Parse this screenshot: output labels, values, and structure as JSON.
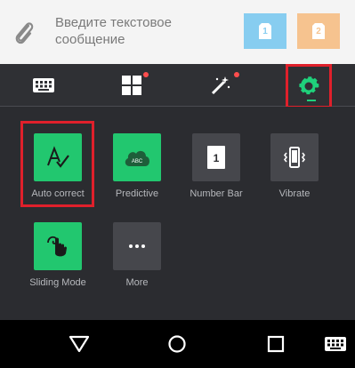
{
  "message_bar": {
    "placeholder": "Введите текстовое сообщение",
    "sim1_label": "1",
    "sim2_label": "2",
    "sim1_color": "#87cdf0",
    "sim2_color": "#f6c38f"
  },
  "toolbar": {
    "items": [
      {
        "icon": "keyboard-icon"
      },
      {
        "icon": "grid-icon",
        "badge": true
      },
      {
        "icon": "magic-wand-icon",
        "badge": true
      },
      {
        "icon": "gear-icon",
        "active": true
      }
    ]
  },
  "settings": {
    "tiles": [
      {
        "label": "Auto correct",
        "icon": "auto-correct-icon",
        "enabled": true
      },
      {
        "label": "Predictive",
        "icon": "predictive-cloud-icon",
        "enabled": true,
        "icon_text": "ABC"
      },
      {
        "label": "Number Bar",
        "icon": "number-bar-icon",
        "enabled": false,
        "icon_text": "1"
      },
      {
        "label": "Vibrate",
        "icon": "vibrate-phone-icon",
        "enabled": false
      },
      {
        "label": "Sliding Mode",
        "icon": "sliding-hand-icon",
        "enabled": true
      },
      {
        "label": "More",
        "icon": "more-dots-icon",
        "enabled": false
      }
    ]
  },
  "accent_color": "#22c76f",
  "highlight_color": "#e0202b"
}
